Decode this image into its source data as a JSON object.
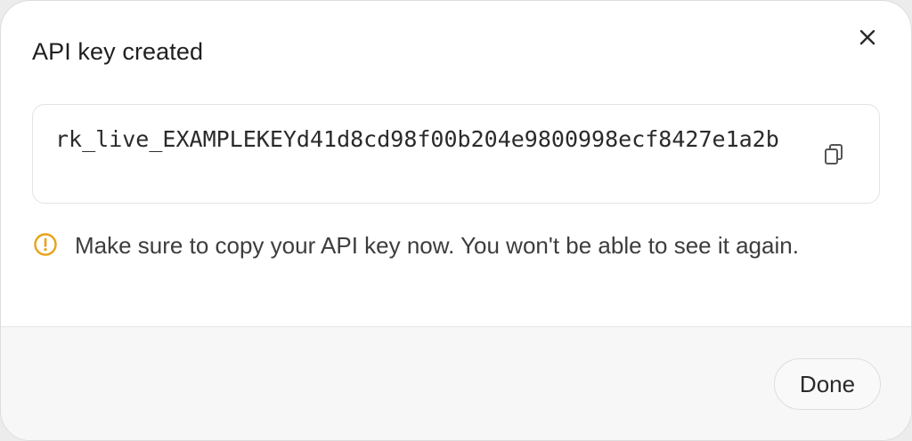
{
  "dialog": {
    "title": "API key created",
    "close_icon": "close-icon",
    "api_key": "rk_live_EXAMPLEKEYd41d8cd98f00b204e9800998ecf8427e1a2b",
    "copy_icon": "copy-icon",
    "warning": {
      "icon": "warning-circle-icon",
      "color": "#e8a317",
      "text": "Make sure to copy your API key now. You won't be able to see it again."
    },
    "done_label": "Done"
  }
}
